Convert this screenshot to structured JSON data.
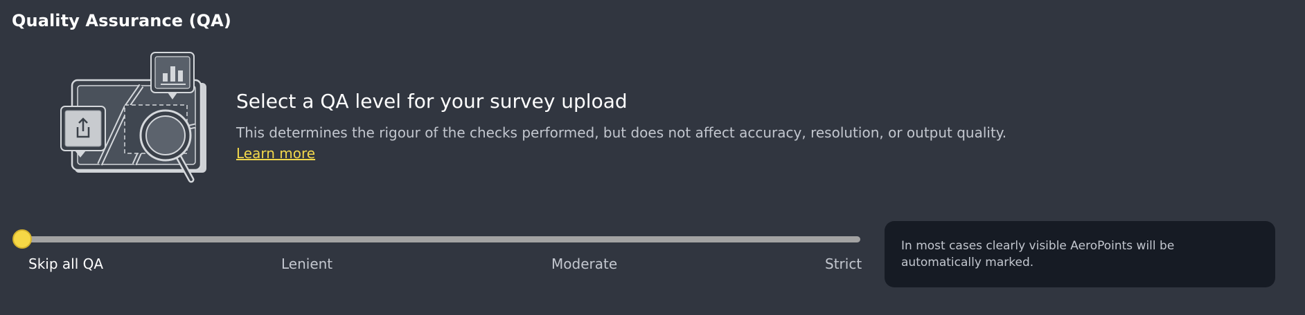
{
  "section": {
    "title": "Quality Assurance (QA)"
  },
  "intro": {
    "heading": "Select a QA level for your survey upload",
    "description": "This determines the rigour of the checks performed, but does not affect accuracy, resolution, or output quality.",
    "learn_more": "Learn more"
  },
  "qa_slider": {
    "levels": [
      "Skip all QA",
      "Lenient",
      "Moderate",
      "Strict"
    ],
    "selected": "Skip all QA",
    "selected_index": 0
  },
  "info": {
    "text": "In most cases clearly visible AeroPoints will be automatically marked."
  },
  "colors": {
    "background": "#313640",
    "accent": "#f6d846",
    "link": "#f2d84b",
    "info_box": "#161b24",
    "track": "#a3a3a3"
  },
  "icons": [
    "upload-icon",
    "bar-chart-icon",
    "magnifier-icon",
    "map-illustration"
  ]
}
